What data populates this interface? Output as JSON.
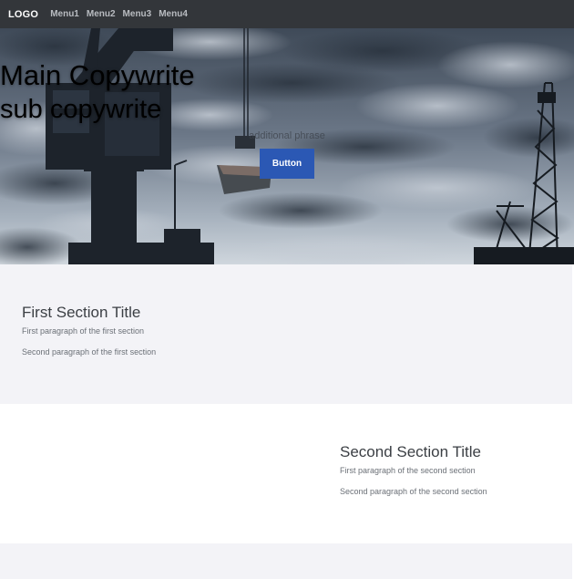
{
  "nav": {
    "logo": "LOGO",
    "menu": [
      "Menu1",
      "Menu2",
      "Menu3",
      "Menu4"
    ]
  },
  "hero": {
    "title": "Main Copywrite",
    "subtitle": "sub copywrite",
    "note": "additional phrase",
    "button_label": "Button"
  },
  "section1": {
    "title": "First Section Title",
    "p1": "First paragraph of the first section",
    "p2": "Second paragraph of the first section"
  },
  "section2": {
    "title": "Second Section Title",
    "p1": "First paragraph of the second section",
    "p2": "Second paragraph of the second section"
  },
  "colors": {
    "navbar": "#33363a",
    "button": "#2b58b4",
    "section_alt": "#f3f3f7"
  }
}
